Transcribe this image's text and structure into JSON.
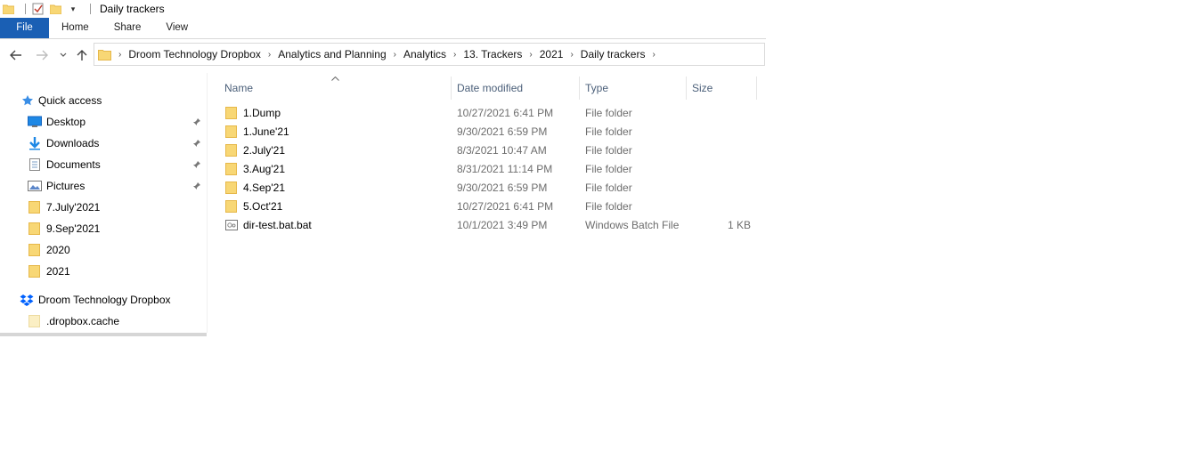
{
  "window": {
    "title": "Daily trackers"
  },
  "ribbon": {
    "tabs": [
      "File",
      "Home",
      "Share",
      "View"
    ]
  },
  "address": {
    "crumbs": [
      "Droom Technology Dropbox",
      "Analytics and Planning",
      "Analytics",
      "13. Trackers",
      "2021",
      "Daily trackers"
    ]
  },
  "sidebar": {
    "quick_access": "Quick access",
    "items": [
      {
        "label": "Desktop",
        "icon": "desktop-icon",
        "pinned": true
      },
      {
        "label": "Downloads",
        "icon": "downloads-icon",
        "pinned": true
      },
      {
        "label": "Documents",
        "icon": "documents-icon",
        "pinned": true
      },
      {
        "label": "Pictures",
        "icon": "pictures-icon",
        "pinned": true
      },
      {
        "label": "7.July'2021",
        "icon": "folder-icon",
        "pinned": false
      },
      {
        "label": "9.Sep'2021",
        "icon": "folder-icon",
        "pinned": false
      },
      {
        "label": "2020",
        "icon": "folder-icon",
        "pinned": false
      },
      {
        "label": "2021",
        "icon": "folder-icon",
        "pinned": false
      }
    ],
    "dropbox": "Droom Technology Dropbox",
    "dropbox_items": [
      {
        "label": ".dropbox.cache",
        "icon": "folder-icon"
      }
    ]
  },
  "columns": {
    "name": "Name",
    "date": "Date modified",
    "type": "Type",
    "size": "Size"
  },
  "files": [
    {
      "name": "1.Dump",
      "date": "10/27/2021 6:41 PM",
      "type": "File folder",
      "size": "",
      "icon": "folder-icon"
    },
    {
      "name": "1.June'21",
      "date": "9/30/2021 6:59 PM",
      "type": "File folder",
      "size": "",
      "icon": "folder-icon"
    },
    {
      "name": "2.July'21",
      "date": "8/3/2021 10:47 AM",
      "type": "File folder",
      "size": "",
      "icon": "folder-icon"
    },
    {
      "name": "3.Aug'21",
      "date": "8/31/2021 11:14 PM",
      "type": "File folder",
      "size": "",
      "icon": "folder-icon"
    },
    {
      "name": "4.Sep'21",
      "date": "9/30/2021 6:59 PM",
      "type": "File folder",
      "size": "",
      "icon": "folder-icon"
    },
    {
      "name": "5.Oct'21",
      "date": "10/27/2021 6:41 PM",
      "type": "File folder",
      "size": "",
      "icon": "folder-icon"
    },
    {
      "name": "dir-test.bat.bat",
      "date": "10/1/2021 3:49 PM",
      "type": "Windows Batch File",
      "size": "1 KB",
      "icon": "batch-file-icon"
    }
  ],
  "colors": {
    "file_tab": "#1a5fb4",
    "folder": "#f8d775",
    "folder_dark": "#e6b84a",
    "header_text": "#4c607a"
  }
}
